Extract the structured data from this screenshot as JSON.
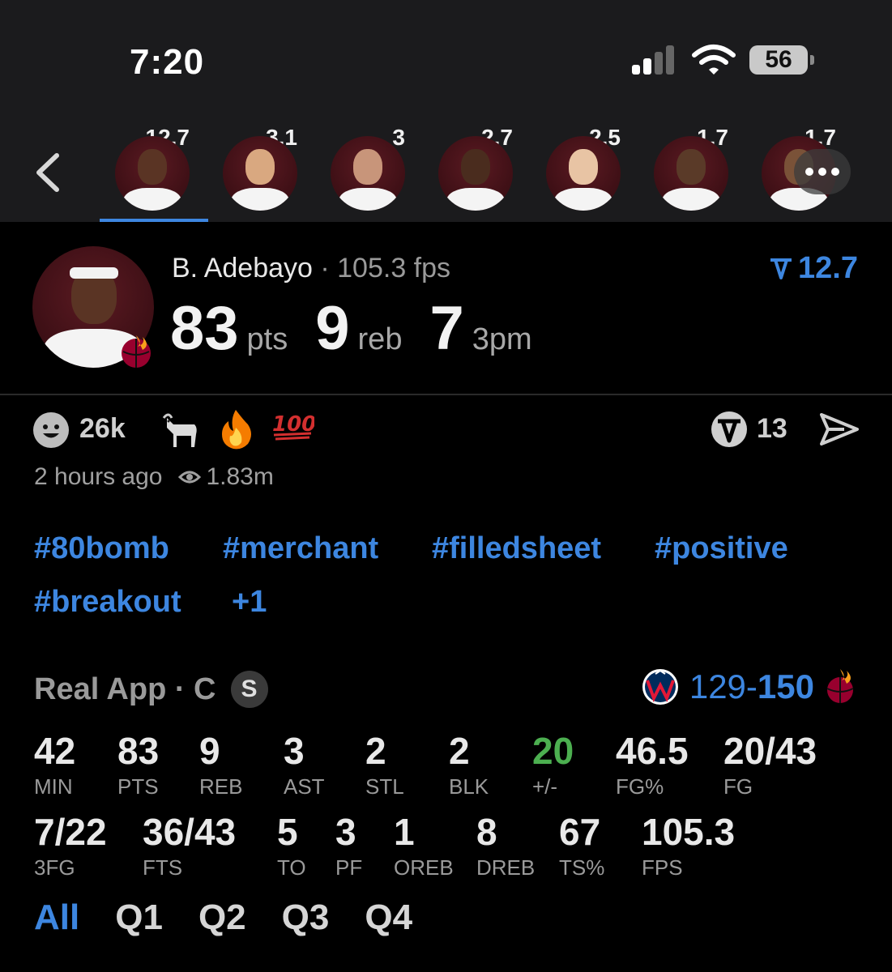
{
  "status_bar": {
    "time": "7:20",
    "battery": "56"
  },
  "player_strip": [
    {
      "score": "12.7",
      "active": true
    },
    {
      "score": "3.1"
    },
    {
      "score": "3"
    },
    {
      "score": "2.7"
    },
    {
      "score": "2.5"
    },
    {
      "score": "1.7"
    },
    {
      "score": "1.7"
    }
  ],
  "player": {
    "name": "B. Adebayo",
    "separator": " · ",
    "fps": "105.3 fps",
    "top_score": "12.7",
    "headline": [
      {
        "value": "83",
        "unit": "pts"
      },
      {
        "value": "9",
        "unit": "reb"
      },
      {
        "value": "7",
        "unit": "3pm"
      }
    ]
  },
  "reactions": {
    "count": "26k",
    "tick_count": "13"
  },
  "meta": {
    "time_ago": "2 hours ago",
    "views": "1.83m"
  },
  "tags": [
    "#80bomb",
    "#merchant",
    "#filledsheet",
    "#positive",
    "#breakout",
    "+1"
  ],
  "game": {
    "source": "Real App · C",
    "badge": "S",
    "away_score": "129",
    "dash": "-",
    "home_score": "150"
  },
  "stats_row1": [
    {
      "value": "42",
      "label": "MIN"
    },
    {
      "value": "83",
      "label": "PTS"
    },
    {
      "value": "9",
      "label": "REB"
    },
    {
      "value": "3",
      "label": "AST"
    },
    {
      "value": "2",
      "label": "STL"
    },
    {
      "value": "2",
      "label": "BLK"
    },
    {
      "value": "20",
      "label": "+/-"
    },
    {
      "value": "46.5",
      "label": "FG%"
    },
    {
      "value": "20/43",
      "label": "FG"
    }
  ],
  "stats_row2": [
    {
      "value": "7/22",
      "label": "3FG"
    },
    {
      "value": "36/43",
      "label": "FTS"
    },
    {
      "value": "5",
      "label": "TO"
    },
    {
      "value": "3",
      "label": "PF"
    },
    {
      "value": "1",
      "label": "OREB"
    },
    {
      "value": "8",
      "label": "DREB"
    },
    {
      "value": "67",
      "label": "TS%"
    },
    {
      "value": "105.3",
      "label": "FPS"
    }
  ],
  "quarter_tabs": [
    "All",
    "Q1",
    "Q2",
    "Q3",
    "Q4"
  ],
  "colors": {
    "accent": "#3d86e0",
    "positive": "#4caf50",
    "team_primary": "#5b1a22"
  }
}
